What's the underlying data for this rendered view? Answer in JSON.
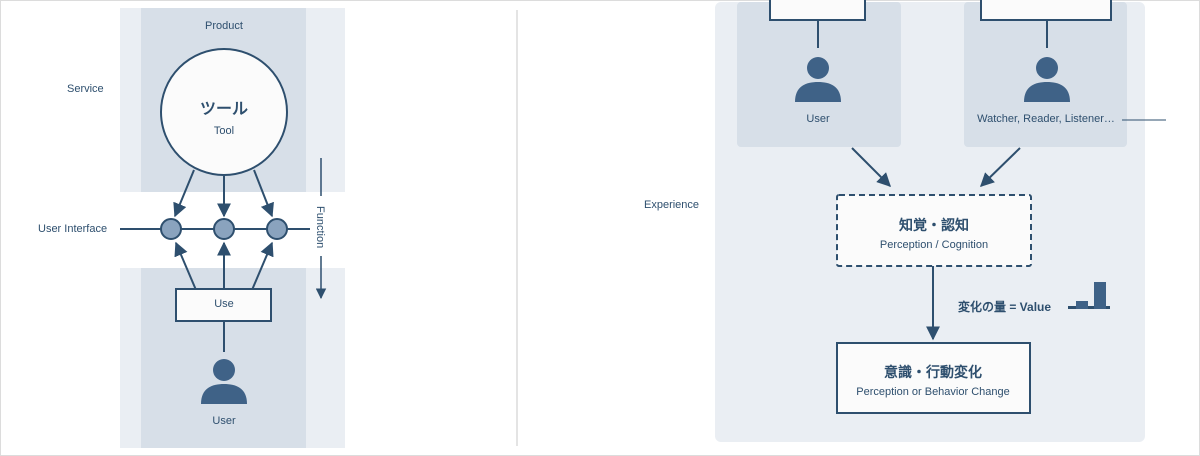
{
  "left": {
    "product_label": "Product",
    "service_label": "Service",
    "tool_jp": "ツール",
    "tool_en": "Tool",
    "user_interface_label": "User Interface",
    "function_label": "Function",
    "use_label": "Use",
    "user_label": "User"
  },
  "right": {
    "user_label": "User",
    "audience_label": "Watcher, Reader, Listener…",
    "experience_label": "Experience",
    "perception_jp": "知覚・認知",
    "perception_en": "Perception / Cognition",
    "value_label": "変化の量 = Value",
    "change_jp": "意識・行動変化",
    "change_en": "Perception or Behavior Change"
  },
  "colors": {
    "ink": "#2e4f6e",
    "panel_light": "#eaeef3",
    "panel_dark": "#d7dfe8",
    "node_fill": "#8aa3be",
    "box_fill": "#fbfbfb"
  }
}
